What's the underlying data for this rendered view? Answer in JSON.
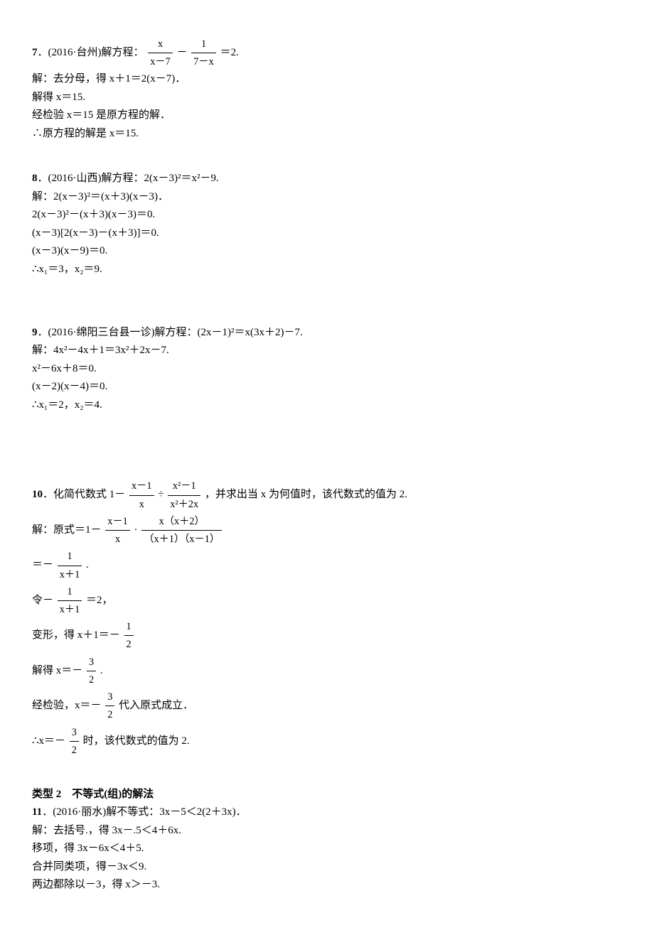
{
  "p7": {
    "num": "7",
    "src": "(2016·台州)解方程：",
    "eq_num1": "x",
    "eq_den1": "x－7",
    "eq_minus": "－",
    "eq_num2": "1",
    "eq_den2": "7－x",
    "eq_tail": "＝2.",
    "l1": "解：去分母，得 x＋1＝2(x－7)．",
    "l2": "解得 x＝15.",
    "l3": "经检验 x＝15 是原方程的解．",
    "l4": "∴原方程的解是 x＝15."
  },
  "p8": {
    "num": "8",
    "src": "(2016·山西)解方程：2(x－3)²＝x²－9.",
    "l1": "解：2(x－3)²＝(x＋3)(x－3)．",
    "l2": "2(x－3)²－(x＋3)(x－3)＝0.",
    "l3": "(x－3)[2(x－3)－(x＋3)]＝0.",
    "l4": "(x－3)(x－9)＝0.",
    "l5": "∴x₁＝3，x₂＝9."
  },
  "p9": {
    "num": "9",
    "src": "(2016·绵阳三台县一诊)解方程：(2x－1)²＝x(3x＋2)－7.",
    "l1": "解：4x²－4x＋1＝3x²＋2x－7.",
    "l2": "x²－6x＋8＝0.",
    "l3": "(x－2)(x－4)＝0.",
    "l4": "∴x₁＝2，x₂＝4."
  },
  "p10": {
    "num": "10",
    "lead1": "化简代数式 1－",
    "f1n": "x－1",
    "f1d": "x",
    "lead2": "÷",
    "f2n": "x²－1",
    "f2d": "x²＋2x",
    "lead3": "，并求出当 x 为何值时，该代数式的值为 2.",
    "s1a": "解：原式＝1－",
    "s1b_n": "x－1",
    "s1b_d": "x",
    "s1c": "·",
    "s1d_n": "x（x＋2）",
    "s1d_d": "（x＋1）（x－1）",
    "s2a": "＝－",
    "s2n": "1",
    "s2d": "x＋1",
    "s2b": ".",
    "s3a": "令－",
    "s3n": "1",
    "s3d": "x＋1",
    "s3b": "＝2，",
    "s4a": "变形，得 x＋1＝－",
    "s4n": "1",
    "s4d": "2",
    "s5a": "解得 x＝－",
    "s5n": "3",
    "s5d": "2",
    "s5b": ".",
    "s6a": "经检验，x＝－",
    "s6n": "3",
    "s6d": "2",
    "s6b": "代入原式成立．",
    "s7a": "∴x＝－",
    "s7n": "3",
    "s7d": "2",
    "s7b": "时，该代数式的值为 2."
  },
  "section2": "类型 2　不等式(组)的解法",
  "p11": {
    "num": "11",
    "src": "(2016·丽水)解不等式：3x－5＜2(2＋3x)．",
    "l1a": "解：去括号",
    "l1b": "，得 3x－",
    "l1c": "5＜4＋6x.",
    "l2": "移项，得 3x－6x＜4＋5.",
    "l3": "合并同类项，得－3x＜9.",
    "l4": "两边都除以－3，得 x＞－3."
  }
}
